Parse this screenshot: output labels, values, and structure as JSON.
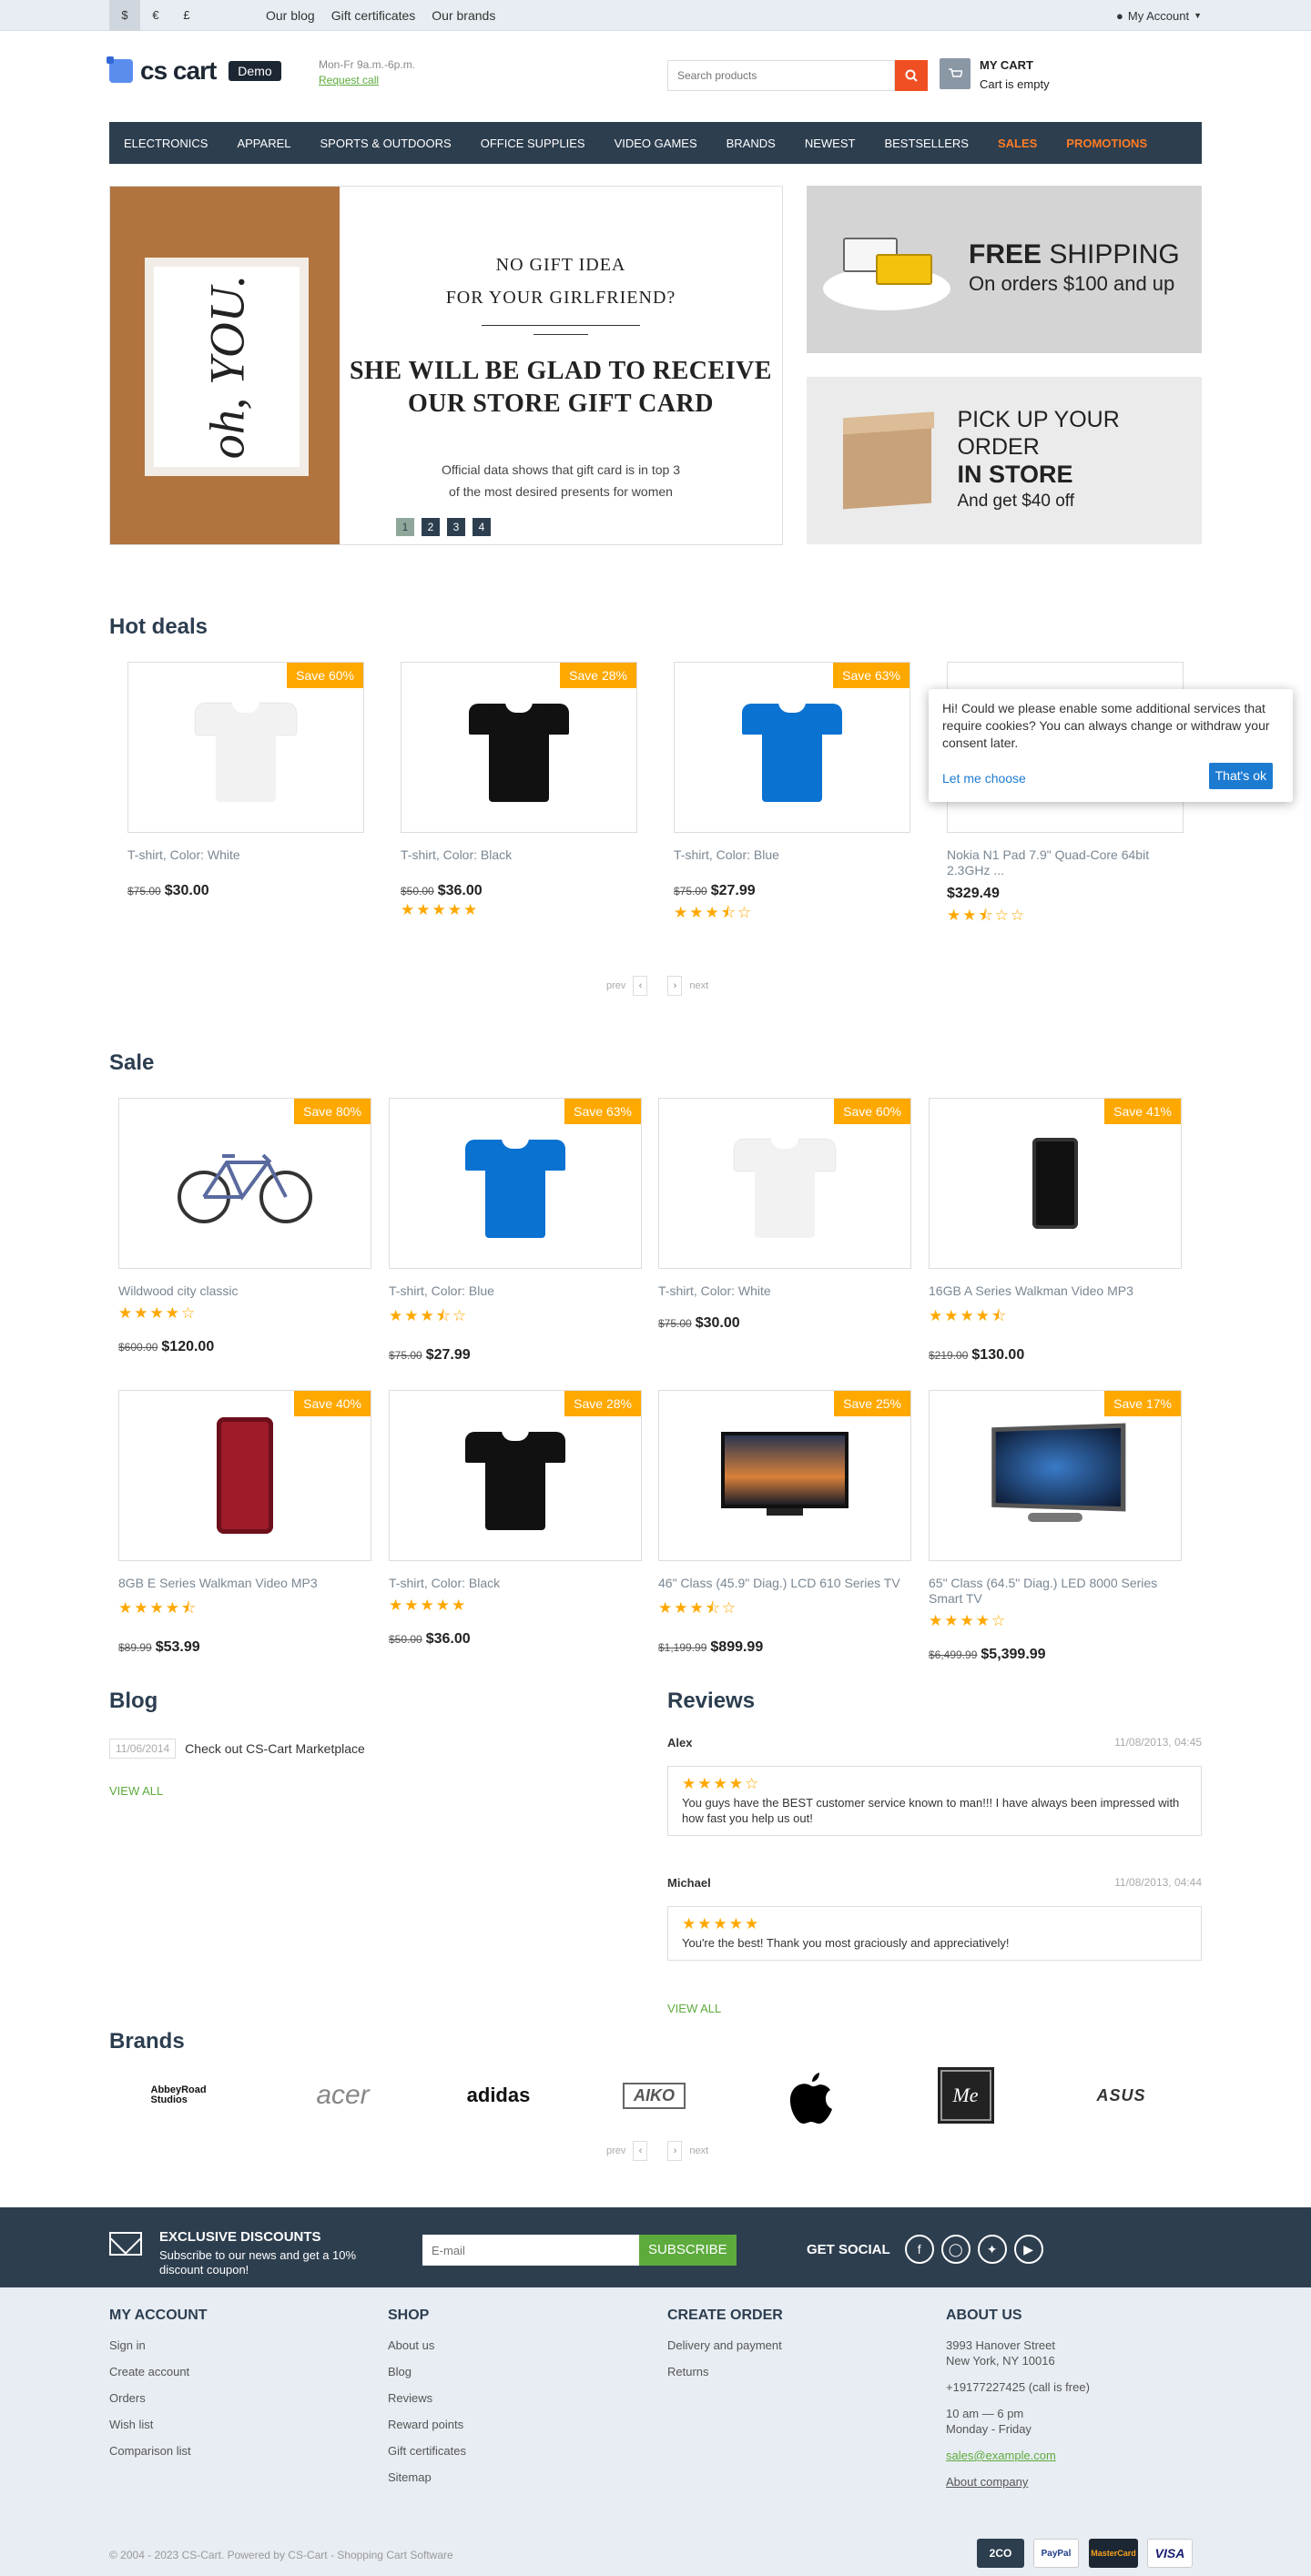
{
  "topbar": {
    "currencies": [
      "$",
      "€",
      "£"
    ],
    "links": [
      "Our blog",
      "Gift certificates",
      "Our brands"
    ],
    "account": "My Account"
  },
  "header": {
    "logo": "cs cart",
    "demo": "Demo",
    "hours": "Mon-Fr 9a.m.-6p.m.",
    "request_call": "Request call",
    "search_placeholder": "Search products",
    "cart_title": "MY CART",
    "cart_status": "Cart is empty"
  },
  "nav": [
    "ELECTRONICS",
    "APPAREL",
    "SPORTS & OUTDOORS",
    "OFFICE SUPPLIES",
    "VIDEO GAMES",
    "BRANDS",
    "NEWEST",
    "BESTSELLERS",
    "SALES",
    "PROMOTIONS"
  ],
  "banner": {
    "card_text": "oh, YOU.",
    "line1": "NO GIFT IDEA",
    "line2": "FOR YOUR GIRLFRIEND?",
    "line3": "SHE WILL BE GLAD TO RECEIVE",
    "line4": "OUR STORE GIFT CARD",
    "line5": "Official data shows that gift card is in top 3",
    "line6": "of the most desired presents for women",
    "dots": [
      "1",
      "2",
      "3",
      "4"
    ]
  },
  "shipping": {
    "free": "FREE",
    "shipping": "SHIPPING",
    "sub": "On orders $100 and up"
  },
  "pickup": {
    "line1": "PICK UP YOUR ORDER",
    "line2": "IN STORE",
    "line3": "And get $40 off"
  },
  "hot_deals": {
    "title": "Hot deals",
    "items": [
      {
        "save": "Save 60%",
        "name": "T-shirt, Color: White",
        "old": "$75.00",
        "price": "$30.00",
        "stars": "",
        "color": "#f2f2f2"
      },
      {
        "save": "Save 28%",
        "name": "T-shirt, Color: Black",
        "old": "$50.00",
        "price": "$36.00",
        "stars": "★★★★★",
        "color": "#111111"
      },
      {
        "save": "Save 63%",
        "name": "T-shirt, Color: Blue",
        "old": "$75.00",
        "price": "$27.99",
        "stars": "★★★⯪☆",
        "color": "#0a72d1"
      },
      {
        "save": "",
        "name": "Nokia N1 Pad 7.9\" Quad-Core 64bit 2.3GHz ...",
        "old": "",
        "price": "$329.49",
        "stars": "★★⯪☆☆",
        "color": ""
      }
    ],
    "prev": "prev",
    "next": "next"
  },
  "cookie": {
    "text": "Hi! Could we please enable some additional services that require cookies? You can always change or withdraw your consent later.",
    "choose": "Let me choose",
    "ok": "That's ok"
  },
  "sale": {
    "title": "Sale",
    "items": [
      {
        "save": "Save 80%",
        "name": "Wildwood city classic",
        "old": "$600.00",
        "price": "$120.00",
        "stars": "★★★★☆"
      },
      {
        "save": "Save 63%",
        "name": "T-shirt, Color: Blue",
        "old": "$75.00",
        "price": "$27.99",
        "stars": "★★★⯪☆"
      },
      {
        "save": "Save 60%",
        "name": "T-shirt, Color: White",
        "old": "$75.00",
        "price": "$30.00",
        "stars": ""
      },
      {
        "save": "Save 41%",
        "name": "16GB A Series Walkman Video MP3",
        "old": "$219.00",
        "price": "$130.00",
        "stars": "★★★★⯪"
      },
      {
        "save": "Save 40%",
        "name": "8GB E Series Walkman Video MP3",
        "old": "$89.99",
        "price": "$53.99",
        "stars": "★★★★⯪"
      },
      {
        "save": "Save 28%",
        "name": "T-shirt, Color: Black",
        "old": "$50.00",
        "price": "$36.00",
        "stars": "★★★★★"
      },
      {
        "save": "Save 25%",
        "name": "46\" Class (45.9\" Diag.) LCD 610 Series TV",
        "old": "$1,199.99",
        "price": "$899.99",
        "stars": "★★★⯪☆"
      },
      {
        "save": "Save 17%",
        "name": "65\" Class (64.5\" Diag.) LED 8000 Series Smart TV",
        "old": "$6,499.99",
        "price": "$5,399.99",
        "stars": "★★★★☆"
      }
    ]
  },
  "blog": {
    "title": "Blog",
    "date": "11/06/2014",
    "post": "Check out CS-Cart Marketplace",
    "view_all": "VIEW ALL"
  },
  "reviews": {
    "title": "Reviews",
    "items": [
      {
        "author": "Alex",
        "date": "11/08/2013, 04:45",
        "stars": "★★★★☆",
        "text": "You guys have the BEST customer service known to man!!! I have always been impressed with how fast you help us out!"
      },
      {
        "author": "Michael",
        "date": "11/08/2013, 04:44",
        "stars": "★★★★★",
        "text": "You're the best! Thank you most graciously and appreciatively!"
      }
    ],
    "view_all": "VIEW ALL"
  },
  "brands": {
    "title": "Brands",
    "items": [
      "AbbeyRoad Studios",
      "acer",
      "adidas",
      "AIKO",
      "Apple",
      "Me",
      "ASUS"
    ],
    "prev": "prev",
    "next": "next"
  },
  "newsletter": {
    "title": "EXCLUSIVE DISCOUNTS",
    "text": "Subscribe to our news and get a 10% discount coupon!",
    "placeholder": "E-mail",
    "button": "SUBSCRIBE",
    "social": "GET SOCIAL"
  },
  "footer": {
    "account": {
      "title": "MY ACCOUNT",
      "links": [
        "Sign in",
        "Create account",
        "Orders",
        "Wish list",
        "Comparison list"
      ]
    },
    "shop": {
      "title": "SHOP",
      "links": [
        "About us",
        "Blog",
        "Reviews",
        "Reward points",
        "Gift certificates",
        "Sitemap"
      ]
    },
    "order": {
      "title": "CREATE ORDER",
      "links": [
        "Delivery and payment",
        "Returns"
      ]
    },
    "about": {
      "title": "ABOUT US",
      "address1": "3993 Hanover Street",
      "address2": "New York, NY 10016",
      "phone": "+19177227425 (call is free)",
      "hours1": "10 am — 6 pm",
      "hours2": "Monday - Friday",
      "email": "sales@example.com",
      "company": "About company"
    },
    "copyright": "© 2004 - 2023 CS-Cart.  Powered by CS-Cart - Shopping Cart Software",
    "payments": [
      "2CO",
      "PayPal",
      "MasterCard",
      "VISA"
    ]
  }
}
